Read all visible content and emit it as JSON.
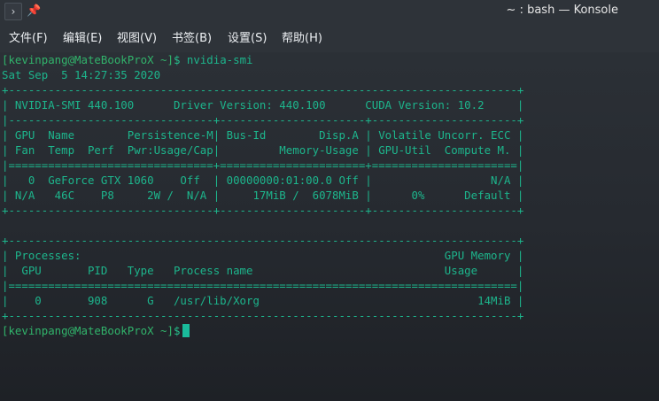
{
  "window": {
    "title": "~ : bash — Konsole",
    "app_icon": "konsole-menu-icon",
    "pin_icon": "pin-icon",
    "pin_glyph": "📌"
  },
  "menubar": {
    "items": [
      {
        "label": "文件(F)"
      },
      {
        "label": "编辑(E)"
      },
      {
        "label": "视图(V)"
      },
      {
        "label": "书签(B)"
      },
      {
        "label": "设置(S)"
      },
      {
        "label": "帮助(H)"
      }
    ]
  },
  "terminal": {
    "colors": {
      "text": "#1db58c",
      "prompt_user": "#31b36b",
      "cursor": "#1abc9c",
      "background": "#262a30"
    },
    "prompt1": {
      "user_host": "[kevinpang@MateBookProX ~]",
      "dollar": "$",
      "command": " nvidia-smi"
    },
    "date": "Sat Sep  5 14:27:35 2020",
    "table_lines": [
      "+-----------------------------------------------------------------------------+",
      "| NVIDIA-SMI 440.100      Driver Version: 440.100      CUDA Version: 10.2     |",
      "|-------------------------------+----------------------+----------------------+",
      "| GPU  Name        Persistence-M| Bus-Id        Disp.A | Volatile Uncorr. ECC |",
      "| Fan  Temp  Perf  Pwr:Usage/Cap|         Memory-Usage | GPU-Util  Compute M. |",
      "|===============================+======================+======================|",
      "|   0  GeForce GTX 1060    Off  | 00000000:01:00.0 Off |                  N/A |",
      "| N/A   46C    P8     2W /  N/A |     17MiB /  6078MiB |      0%      Default |",
      "+-------------------------------+----------------------+----------------------+",
      "",
      "+-----------------------------------------------------------------------------+",
      "| Processes:                                                       GPU Memory |",
      "|  GPU       PID   Type   Process name                             Usage      |",
      "|=============================================================================|",
      "|    0       908      G   /usr/lib/Xorg                                 14MiB |",
      "+-----------------------------------------------------------------------------+"
    ],
    "prompt2": {
      "user_host": "[kevinpang@MateBookProX ~]",
      "dollar": "$"
    }
  }
}
